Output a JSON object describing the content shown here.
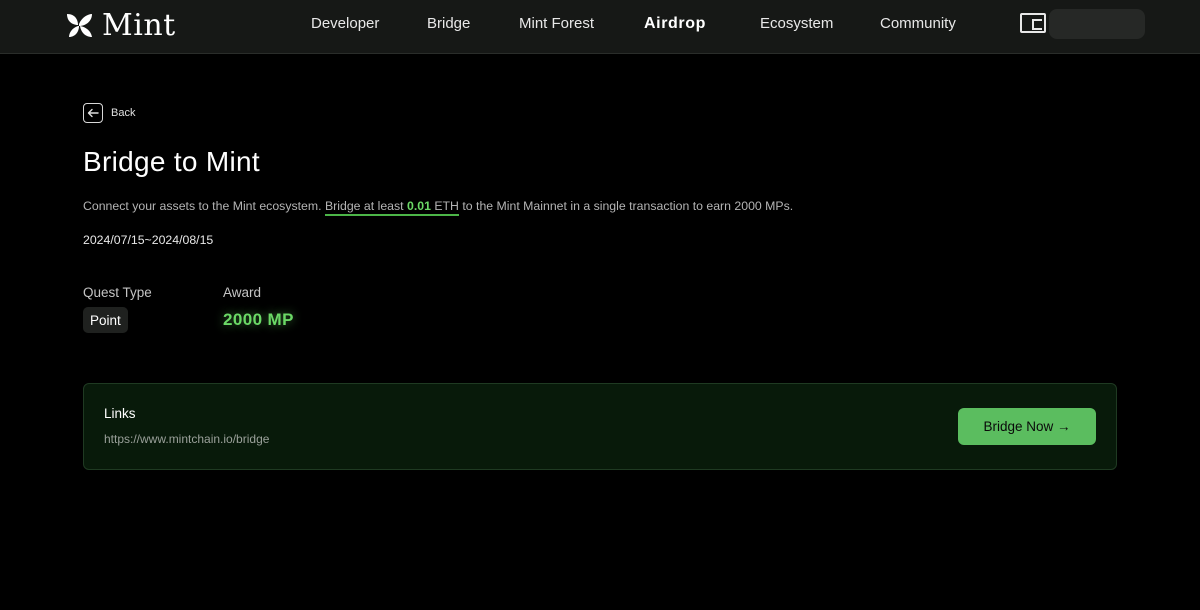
{
  "brand": {
    "name": "Mint"
  },
  "nav": {
    "items": [
      {
        "label": "Developer"
      },
      {
        "label": "Bridge"
      },
      {
        "label": "Mint Forest"
      },
      {
        "label": "Airdrop",
        "active": true
      },
      {
        "label": "Ecosystem"
      },
      {
        "label": "Community"
      }
    ],
    "wallet_icon": "wallet-icon"
  },
  "back": {
    "label": "Back",
    "icon": "arrow-left-icon"
  },
  "quest": {
    "title": "Bridge to Mint",
    "description": {
      "before": "Connect your assets to the Mint ecosystem. ",
      "highlight_before": "Bridge at least ",
      "amount": "0.01",
      "highlight_after": " ETH",
      "after": " to the Mint Mainnet in a single transaction to earn 2000 MPs."
    },
    "dates": "2024/07/15~2024/08/15",
    "quest_type_label": "Quest Type",
    "quest_type_value": "Point",
    "award_label": "Award",
    "award_value": "2000 MP"
  },
  "links": {
    "title": "Links",
    "url": "https://www.mintchain.io/bridge",
    "button_label": "Bridge Now →"
  },
  "colors": {
    "accent_green": "#6bd866",
    "button_green": "#5bbd5f",
    "card_bg": "#081a0a",
    "page_bg": "#000000"
  }
}
